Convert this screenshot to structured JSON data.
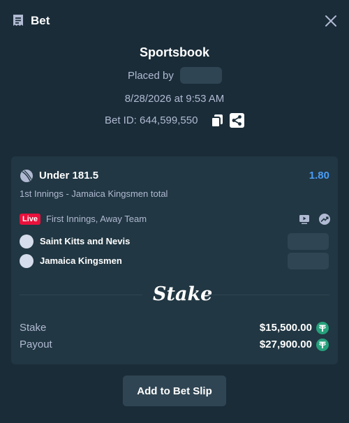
{
  "header": {
    "title": "Bet"
  },
  "info": {
    "sportsbook": "Sportsbook",
    "placed_by": "Placed by",
    "datetime": "8/28/2026 at 9:53 AM",
    "bet_id": "Bet ID: 644,599,550"
  },
  "card": {
    "market": "Under 181.5",
    "odds": "1.80",
    "sub": "1st Innings - Jamaica Kingsmen total",
    "live_badge": "Live",
    "status": "First Innings, Away Team",
    "teams": [
      {
        "name": "Saint Kitts and Nevis"
      },
      {
        "name": "Jamaica Kingsmen"
      }
    ],
    "logo": "Stake",
    "stake_label": "Stake",
    "stake_value": "$15,500.00",
    "payout_label": "Payout",
    "payout_value": "$27,900.00"
  },
  "actions": {
    "add_to_bet_slip": "Add to Bet Slip"
  },
  "colors": {
    "background": "#1a2c38",
    "card": "#213743",
    "accent_odds": "#4a9cf5",
    "live": "#e9113c",
    "usdt": "#26a17b"
  },
  "icons": [
    "bet-slip-icon",
    "close-icon",
    "copy-icon",
    "share-icon",
    "cricket-ball-icon",
    "tv-icon",
    "trend-icon",
    "usdt-icon"
  ]
}
